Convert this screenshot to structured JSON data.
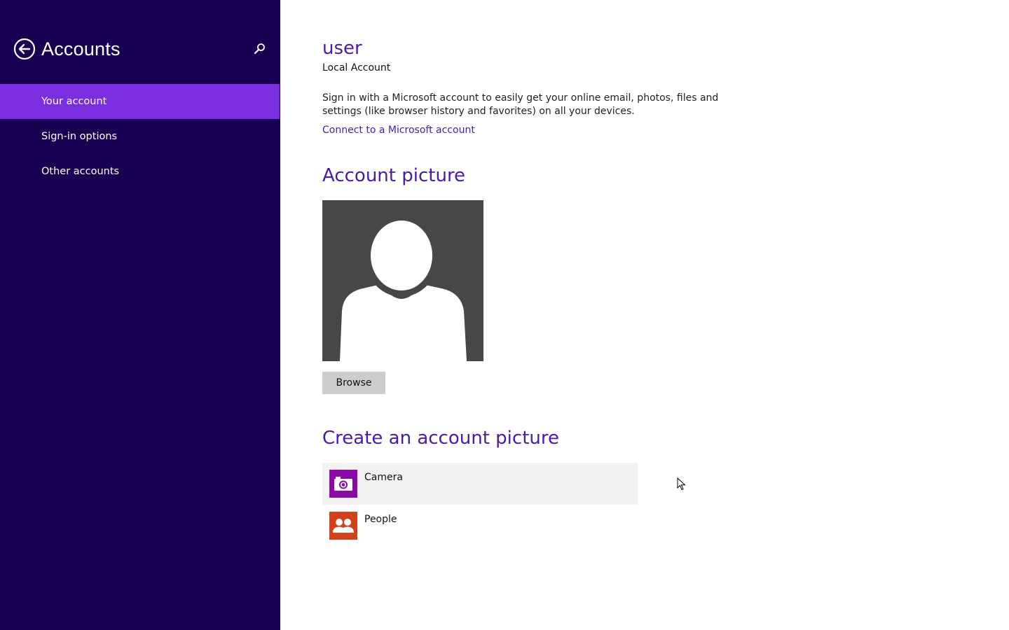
{
  "sidebar": {
    "title": "Accounts",
    "back_icon": "back-arrow-circle-icon",
    "search_icon": "search-icon",
    "background_color": "#180052",
    "selected_color": "#7a2ee0",
    "items": [
      {
        "label": "Your account",
        "selected": true
      },
      {
        "label": "Sign-in options",
        "selected": false
      },
      {
        "label": "Other accounts",
        "selected": false
      }
    ]
  },
  "main": {
    "user_name": "user",
    "account_type": "Local Account",
    "description": "Sign in with a Microsoft account to easily get your online email, photos, files and settings (like browser history and favorites) on all your devices.",
    "connect_link": "Connect to a Microsoft account",
    "account_picture": {
      "title": "Account picture",
      "avatar_icon": "default-user-silhouette-icon",
      "browse_label": "Browse"
    },
    "create_picture": {
      "title": "Create an account picture",
      "apps": [
        {
          "label": "Camera",
          "icon": "camera-icon",
          "tile_color": "#8a0aa8"
        },
        {
          "label": "People",
          "icon": "people-icon",
          "tile_color": "#d2401c"
        }
      ]
    },
    "accent_color": "#4b1aa8"
  }
}
